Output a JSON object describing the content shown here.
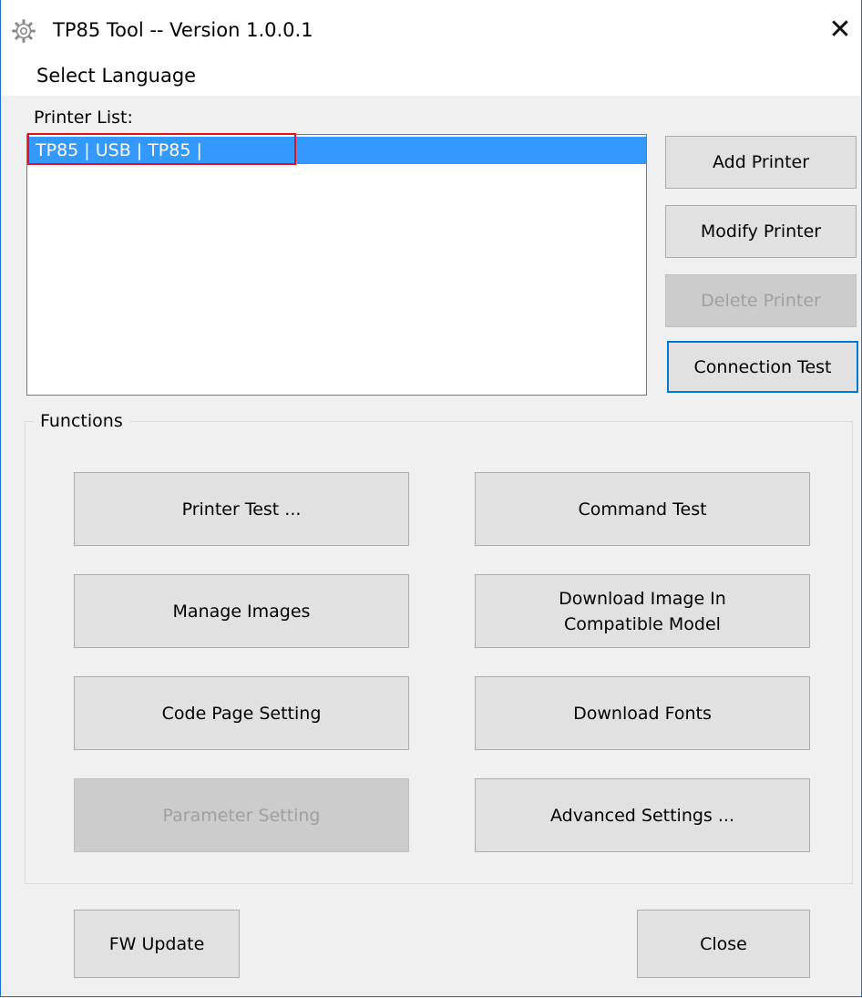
{
  "window": {
    "title": "TP85 Tool -- Version 1.0.0.1",
    "icon": "gear-icon",
    "close_glyph": "✕"
  },
  "menu": {
    "items": [
      "Select Language"
    ]
  },
  "printer_list": {
    "label": "Printer List:",
    "items": [
      "TP85 | USB | TP85 |"
    ],
    "selected_index": 0,
    "selection_color": "#3399ff",
    "annotation_color": "#e0121b"
  },
  "printer_buttons": {
    "add": "Add Printer",
    "modify": "Modify Printer",
    "delete": "Delete Printer",
    "connection_test": "Connection Test"
  },
  "functions": {
    "title": "Functions",
    "printer_test": "Printer Test ...",
    "command_test": "Command Test",
    "manage_images": "Manage Images",
    "download_image_line1": "Download Image In",
    "download_image_line2": "Compatible Model",
    "code_page": "Code Page Setting",
    "download_fonts": "Download Fonts",
    "parameter_setting": "Parameter Setting",
    "advanced_settings": "Advanced Settings ..."
  },
  "footer": {
    "fw_update": "FW Update",
    "close": "Close"
  },
  "colors": {
    "accent": "#0078d7",
    "window_border": "#1e6fd0"
  }
}
